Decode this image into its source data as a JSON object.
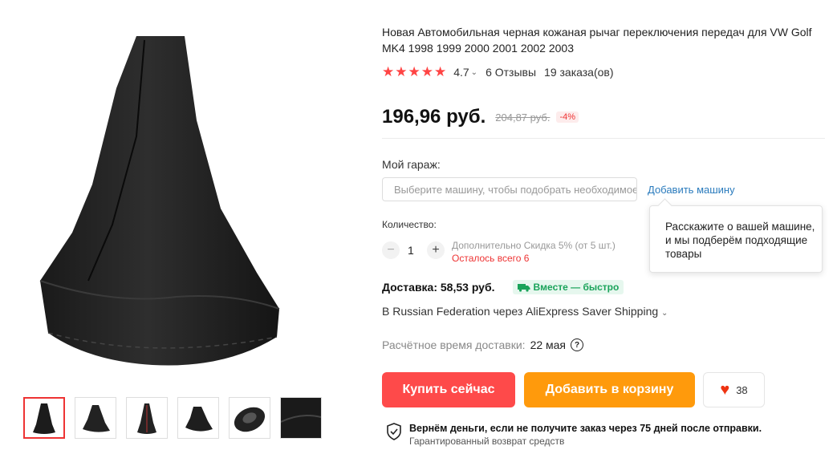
{
  "product": {
    "title": "Новая Автомобильная черная кожаная рычаг переключения передач для VW Golf MK4 1998 1999 2000 2001 2002 2003",
    "rating": "4.7",
    "reviews": "6 Отзывы",
    "orders": "19 заказа(ов)"
  },
  "price": {
    "current": "196,96 руб.",
    "old": "204,87 руб.",
    "discount": "-4%"
  },
  "garage": {
    "label": "Мой гараж:",
    "placeholder": "Выберите машину, чтобы подобрать необходимое",
    "add_link": "Добавить машину",
    "tooltip": "Расскажите о вашей машине, и мы подберём подходящие товары"
  },
  "quantity": {
    "label": "Количество:",
    "value": "1",
    "note": "Дополнительно Скидка 5% (от 5 шт.)",
    "left": "Осталось всего 6"
  },
  "shipping": {
    "price": "Доставка: 58,53 руб.",
    "badge": "Вместе — быстро",
    "via": "В Russian Federation через AliExpress Saver Shipping",
    "eta_label": "Расчётное время доставки:",
    "eta_date": "22 мая"
  },
  "actions": {
    "buy": "Купить сейчас",
    "cart": "Добавить в корзину",
    "wish_count": "38"
  },
  "guarantee": {
    "line1": "Вернём деньги, если не получите заказ через 75 дней после отправки.",
    "line2": "Гарантированный возврат средств"
  },
  "icons": {
    "stars": "star-icon",
    "help": "question-circle-icon",
    "heart": "heart-icon",
    "shield": "shield-check-icon",
    "truck": "truck-icon"
  },
  "colors": {
    "buy": "#fe4a4a",
    "cart": "#ff9a0c",
    "stars": "#f44444",
    "fast": "#1aa35a"
  }
}
